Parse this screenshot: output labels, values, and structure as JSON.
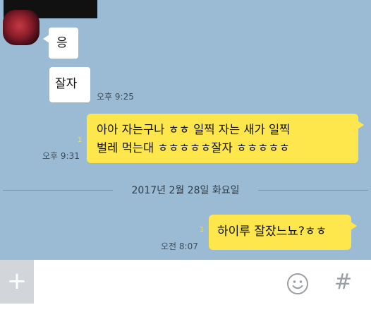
{
  "chat": {
    "messages": [
      {
        "sender": "other",
        "text": "응"
      },
      {
        "sender": "other",
        "text": "잘자",
        "time": "오후 9:25"
      },
      {
        "sender": "me",
        "line1": "아아 자는구나 ㅎㅎ 일찍 자는 새가 일찍",
        "line2": "벌레 먹는대 ㅎㅎㅎㅎㅎ잘자 ㅎㅎㅎㅎㅎ",
        "time": "오후 9:31",
        "unread": "1"
      },
      {
        "sender": "me",
        "text": "하이루 잘잤느뇨?ㅎㅎ",
        "time": "오전 8:07",
        "unread": "1"
      }
    ],
    "date_divider": "2017년 2월 28일 화요일"
  },
  "input": {
    "plus_label": "+",
    "hash_label": "#",
    "placeholder": ""
  },
  "icons": {
    "attach": "plus-icon",
    "emoticon": "smiley-icon",
    "search": "hash-icon"
  },
  "colors": {
    "chat_bg": "#9bbbd4",
    "my_bubble": "#fde74c",
    "other_bubble": "#ffffff"
  }
}
